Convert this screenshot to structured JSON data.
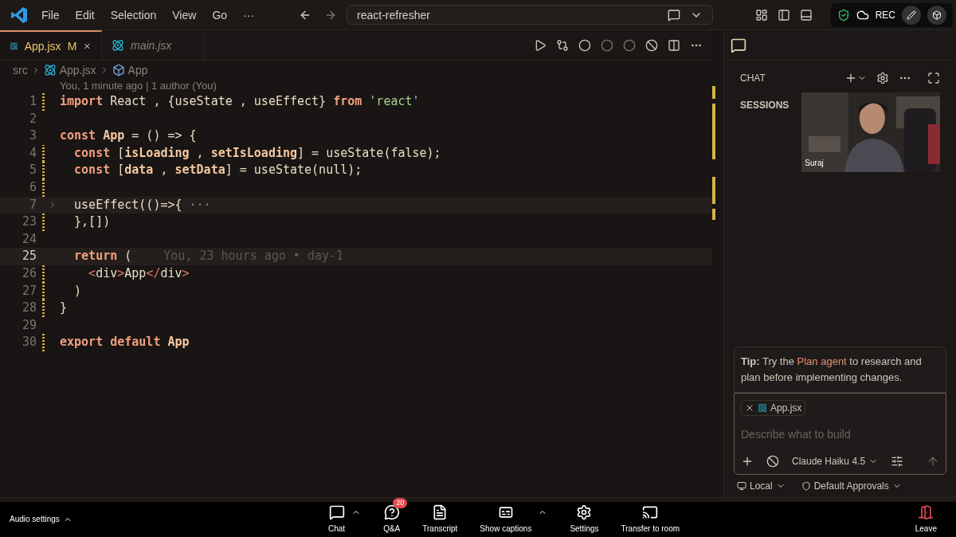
{
  "titlebar": {
    "menu": [
      "File",
      "Edit",
      "Selection",
      "View",
      "Go"
    ],
    "more": "···",
    "search": "react-refresher"
  },
  "recording": {
    "label": "REC"
  },
  "tabs": [
    {
      "label": "App.jsx",
      "badge": "M",
      "selected": true,
      "preview": false
    },
    {
      "label": "main.jsx",
      "selected": false,
      "preview": true
    }
  ],
  "breadcrumb": [
    "src",
    "App.jsx",
    "App"
  ],
  "blame_header": "You, 1 minute ago | 1 author (You)",
  "code": [
    {
      "number": "1",
      "modified": true,
      "tokens": [
        {
          "t": "import ",
          "kind": "kw"
        },
        {
          "t": "React , {useState , useEffect} ",
          "kind": "plain"
        },
        {
          "t": "from ",
          "kind": "kw"
        },
        {
          "t": "'react'",
          "kind": "str"
        }
      ]
    },
    {
      "number": "2",
      "modified": false
    },
    {
      "number": "3",
      "modified": false,
      "tokens": [
        {
          "t": "const ",
          "kind": "kw"
        },
        {
          "t": "App",
          "kind": "var"
        },
        {
          "t": " = () => {",
          "kind": "plain"
        }
      ]
    },
    {
      "number": "4",
      "modified": true,
      "tokens": [
        {
          "t": "  const ",
          "kind": "kw"
        },
        {
          "t": "[",
          "kind": "plain"
        },
        {
          "t": "isLoading",
          "kind": "var"
        },
        {
          "t": " , ",
          "kind": "plain"
        },
        {
          "t": "setIsLoading",
          "kind": "var"
        },
        {
          "t": "] = useState(false);",
          "kind": "plain"
        }
      ]
    },
    {
      "number": "5",
      "modified": true,
      "tokens": [
        {
          "t": "  const ",
          "kind": "kw"
        },
        {
          "t": "[",
          "kind": "plain"
        },
        {
          "t": "data",
          "kind": "var"
        },
        {
          "t": " , ",
          "kind": "plain"
        },
        {
          "t": "setData",
          "kind": "var"
        },
        {
          "t": "] = useState(null);",
          "kind": "plain"
        }
      ]
    },
    {
      "number": "6",
      "modified": true
    },
    {
      "number": "7",
      "modified": false,
      "folded": true,
      "tokens": [
        {
          "t": "  useEffect(()=>{",
          "kind": "plain"
        },
        {
          "t": " ···",
          "kind": "dim"
        }
      ]
    },
    {
      "number": "23",
      "modified": true,
      "tokens": [
        {
          "t": "  },[])",
          "kind": "plain"
        }
      ]
    },
    {
      "number": "24",
      "modified": false
    },
    {
      "number": "25",
      "modified": false,
      "current": true,
      "blame": "You, 23 hours ago • day-1",
      "tokens": [
        {
          "t": "  return ",
          "kind": "kw"
        },
        {
          "t": "(",
          "kind": "plain"
        }
      ]
    },
    {
      "number": "26",
      "modified": true,
      "tokens": [
        {
          "t": "    <",
          "kind": "tag"
        },
        {
          "t": "div",
          "kind": "plain"
        },
        {
          "t": ">",
          "kind": "tag"
        },
        {
          "t": "App",
          "kind": "plain"
        },
        {
          "t": "</",
          "kind": "tag"
        },
        {
          "t": "div",
          "kind": "plain"
        },
        {
          "t": ">",
          "kind": "tag"
        }
      ]
    },
    {
      "number": "27",
      "modified": true,
      "tokens": [
        {
          "t": "  )",
          "kind": "plain"
        }
      ]
    },
    {
      "number": "28",
      "modified": true,
      "tokens": [
        {
          "t": "}",
          "kind": "plain"
        }
      ]
    },
    {
      "number": "29",
      "modified": false
    },
    {
      "number": "30",
      "modified": true,
      "tokens": [
        {
          "t": "export default ",
          "kind": "kw"
        },
        {
          "t": "App",
          "kind": "var"
        }
      ]
    }
  ],
  "chat": {
    "title": "CHAT",
    "sessions": "SESSIONS",
    "video": {
      "name": "Suraj"
    },
    "tip": {
      "label": "Tip:",
      "before": " Try the ",
      "link": "Plan agent",
      "after": " to research and plan before implementing changes."
    },
    "attachment": "App.jsx",
    "placeholder": "Describe what to build",
    "model": "Claude Haiku 4.5",
    "location": "Local",
    "approvals": "Default Approvals"
  },
  "meeting": {
    "audio": "Audio settings",
    "buttons": [
      {
        "kind": "chat",
        "label": "Chat",
        "caret": true
      },
      {
        "kind": "qa",
        "label": "Q&A",
        "badge": "20",
        "caret": false
      },
      {
        "kind": "transcript",
        "label": "Transcript",
        "caret": false
      },
      {
        "kind": "captions",
        "label": "Show captions",
        "caret": true
      },
      {
        "kind": "settings",
        "label": "Settings",
        "caret": false
      },
      {
        "kind": "transfer",
        "label": "Transfer to room",
        "caret": false
      }
    ],
    "leave": "Leave"
  }
}
